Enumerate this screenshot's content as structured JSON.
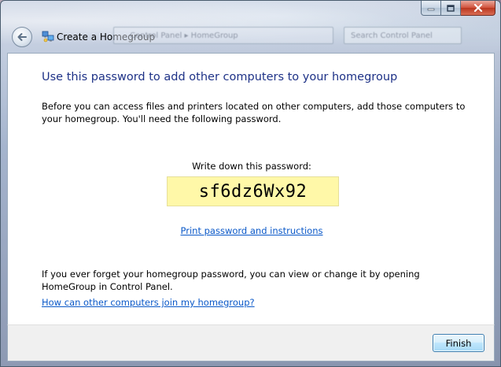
{
  "window": {
    "title": "Create a Homegroup",
    "ghost_address": "Control Panel  ▸  HomeGroup",
    "ghost_search": "Search Control Panel"
  },
  "icons": {
    "back": "back-arrow-icon",
    "homegroup": "homegroup-icon",
    "minimize": "minimize-icon",
    "maximize": "maximize-icon",
    "close": "close-icon"
  },
  "main": {
    "heading": "Use this password to add other computers to your homegroup",
    "intro": "Before you can access files and printers located on other computers, add those computers to your homegroup. You'll need the following password.",
    "password_label": "Write down this password:",
    "password": "sf6dz6Wx92",
    "print_link": "Print password and instructions",
    "forget_text": "If you ever forget your homegroup password, you can view or change it by opening HomeGroup in Control Panel.",
    "help_link": "How can other computers join my homegroup?"
  },
  "footer": {
    "finish_label": "Finish"
  },
  "colors": {
    "heading": "#1e3287",
    "link": "#0a58c8",
    "password_bg": "#fff8a8"
  }
}
